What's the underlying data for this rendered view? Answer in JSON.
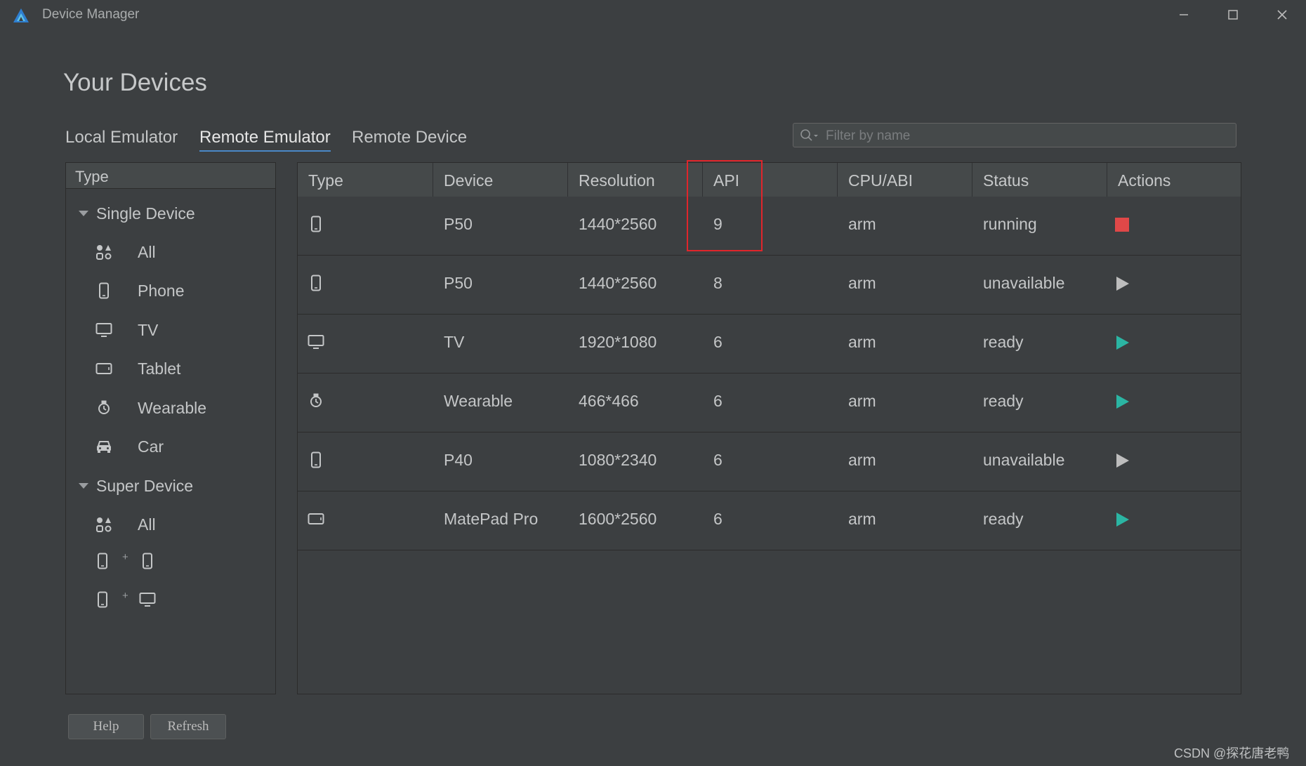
{
  "window": {
    "title": "Device Manager"
  },
  "page_title": "Your Devices",
  "tabs": [
    {
      "label": "Local Emulator",
      "active": false
    },
    {
      "label": "Remote Emulator",
      "active": true
    },
    {
      "label": "Remote Device",
      "active": false
    }
  ],
  "search": {
    "placeholder": "Filter by name",
    "value": ""
  },
  "sidebar": {
    "header": "Type",
    "groups": [
      {
        "label": "Single Device",
        "items": [
          {
            "label": "All",
            "icon": "grid-shapes-icon"
          },
          {
            "label": "Phone",
            "icon": "phone-icon"
          },
          {
            "label": "TV",
            "icon": "tv-icon"
          },
          {
            "label": "Tablet",
            "icon": "tablet-icon"
          },
          {
            "label": "Wearable",
            "icon": "watch-icon"
          },
          {
            "label": "Car",
            "icon": "car-icon"
          }
        ]
      },
      {
        "label": "Super Device",
        "items": [
          {
            "label": "All",
            "icon": "grid-shapes-icon"
          },
          {
            "combo": [
              "phone-icon",
              "phone-icon"
            ],
            "plus": "+"
          },
          {
            "combo": [
              "phone-icon",
              "tv-icon"
            ],
            "plus": "+"
          }
        ]
      }
    ]
  },
  "table": {
    "columns": [
      "Type",
      "Device",
      "Resolution",
      "API",
      "CPU/ABI",
      "Status",
      "Actions"
    ],
    "rows": [
      {
        "type_icon": "phone-icon",
        "device": "P50",
        "resolution": "1440*2560",
        "api": "9",
        "cpu": "arm",
        "status": "running",
        "action": "stop-icon"
      },
      {
        "type_icon": "phone-icon",
        "device": "P50",
        "resolution": "1440*2560",
        "api": "8",
        "cpu": "arm",
        "status": "unavailable",
        "action": "play-icon-disabled"
      },
      {
        "type_icon": "tv-icon",
        "device": "TV",
        "resolution": "1920*1080",
        "api": "6",
        "cpu": "arm",
        "status": "ready",
        "action": "play-icon"
      },
      {
        "type_icon": "watch-icon",
        "device": "Wearable",
        "resolution": "466*466",
        "api": "6",
        "cpu": "arm",
        "status": "ready",
        "action": "play-icon"
      },
      {
        "type_icon": "phone-icon",
        "device": "P40",
        "resolution": "1080*2340",
        "api": "6",
        "cpu": "arm",
        "status": "unavailable",
        "action": "play-icon-disabled"
      },
      {
        "type_icon": "tablet-icon",
        "device": "MatePad Pro",
        "resolution": "1600*2560",
        "api": "6",
        "cpu": "arm",
        "status": "ready",
        "action": "play-icon"
      }
    ]
  },
  "buttons": {
    "help": "Help",
    "refresh": "Refresh"
  },
  "watermark": "CSDN @探花唐老鸭",
  "colors": {
    "background": "#3c3f41",
    "header": "#45494a",
    "accent_tab_underline": "#4a88c7",
    "play_ready": "#2bb5a3",
    "play_disabled": "#bdbdbd",
    "stop": "#e04848",
    "highlight_box": "#e0252b"
  }
}
